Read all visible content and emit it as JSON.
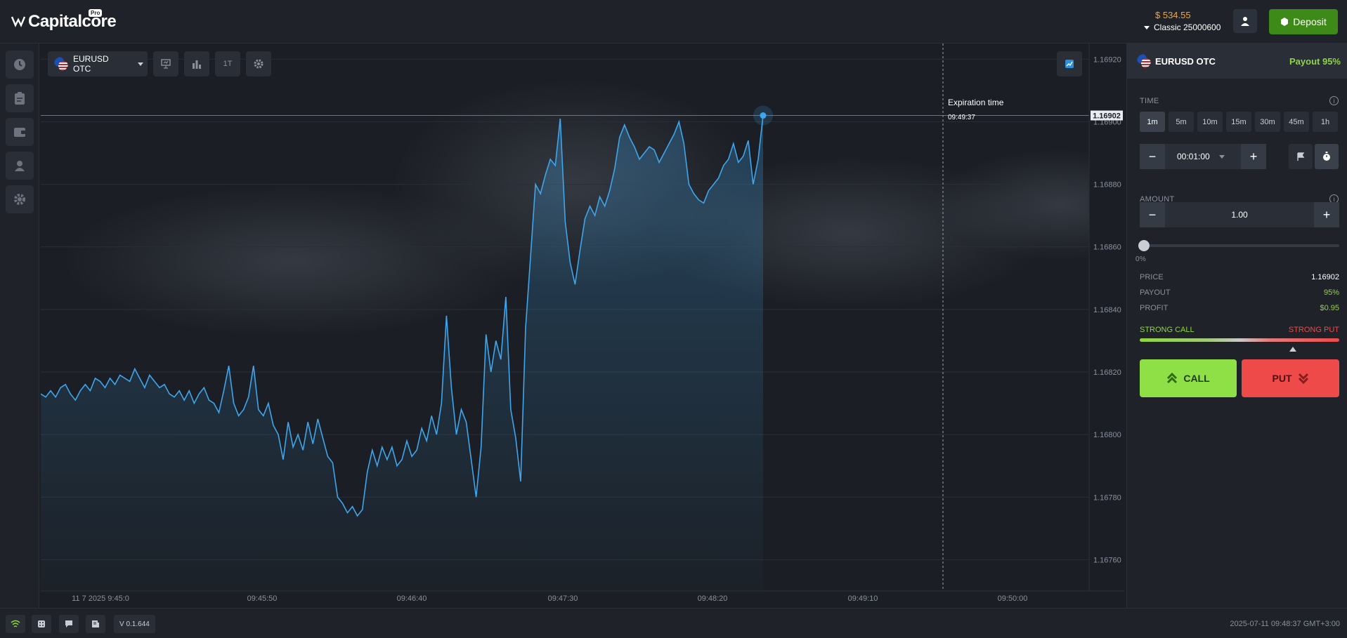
{
  "app": {
    "logo_text": "Capitalcore",
    "logo_badge": "Pro"
  },
  "header": {
    "balance": "$ 534.55",
    "account": "Classic 25000600",
    "deposit_label": "Deposit"
  },
  "toolbar": {
    "asset": "EURUSD OTC",
    "timeframe_label": "1T"
  },
  "chart": {
    "expiration_label": "Expiration time",
    "expiration_time": "09:49:37",
    "current_price": "1.16902",
    "line_color": "#3ea6ec"
  },
  "chart_data": {
    "type": "line",
    "title": "",
    "xlabel": "",
    "ylabel": "",
    "ylim": [
      1.1675,
      1.16925
    ],
    "x_ticks": [
      "11 7 2025 9:45:0",
      "09:45:50",
      "09:46:40",
      "09:47:30",
      "09:48:20",
      "09:49:10",
      "09:50:00"
    ],
    "y_ticks": [
      "1.16920",
      "1.16900",
      "1.16880",
      "1.16860",
      "1.16840",
      "1.16820",
      "1.16800",
      "1.16780",
      "1.16760"
    ],
    "series": [
      {
        "values": [
          1.16813,
          1.16812,
          1.16814,
          1.16812,
          1.16815,
          1.16816,
          1.16813,
          1.16811,
          1.16814,
          1.16816,
          1.16814,
          1.16818,
          1.16817,
          1.16815,
          1.16818,
          1.16816,
          1.16819,
          1.16818,
          1.16817,
          1.16821,
          1.16818,
          1.16815,
          1.16819,
          1.16817,
          1.16815,
          1.16816,
          1.16813,
          1.16812,
          1.16814,
          1.16811,
          1.16814,
          1.1681,
          1.16813,
          1.16815,
          1.16811,
          1.1681,
          1.16807,
          1.16814,
          1.16822,
          1.1681,
          1.16806,
          1.16808,
          1.16812,
          1.16822,
          1.16808,
          1.16806,
          1.1681,
          1.16803,
          1.168,
          1.16792,
          1.16804,
          1.16796,
          1.168,
          1.16795,
          1.16804,
          1.16797,
          1.16805,
          1.16799,
          1.16793,
          1.16791,
          1.1678,
          1.16778,
          1.16775,
          1.16777,
          1.16774,
          1.16776,
          1.16788,
          1.16795,
          1.1679,
          1.16796,
          1.16792,
          1.16796,
          1.1679,
          1.16792,
          1.16798,
          1.16793,
          1.16795,
          1.16802,
          1.16798,
          1.16806,
          1.168,
          1.1681,
          1.16838,
          1.16815,
          1.168,
          1.16808,
          1.16804,
          1.16792,
          1.1678,
          1.16796,
          1.16832,
          1.1682,
          1.1683,
          1.16824,
          1.16844,
          1.16808,
          1.16799,
          1.16785,
          1.16834,
          1.16857,
          1.1688,
          1.16877,
          1.16883,
          1.16888,
          1.16886,
          1.16901,
          1.16868,
          1.16855,
          1.16848,
          1.16859,
          1.16869,
          1.16873,
          1.1687,
          1.16876,
          1.16873,
          1.16878,
          1.16885,
          1.16895,
          1.16899,
          1.16895,
          1.16892,
          1.16888,
          1.1689,
          1.16892,
          1.16891,
          1.16887,
          1.1689,
          1.16893,
          1.16896,
          1.169,
          1.16893,
          1.1688,
          1.16877,
          1.16875,
          1.16874,
          1.16878,
          1.1688,
          1.16882,
          1.16886,
          1.16888,
          1.16893,
          1.16887,
          1.16889,
          1.16894,
          1.1688,
          1.16888,
          1.16902
        ]
      }
    ]
  },
  "panel": {
    "asset": "EURUSD OTC",
    "payout_header": "Payout 95%",
    "time_label": "TIME",
    "time_options": [
      "1m",
      "5m",
      "10m",
      "15m",
      "30m",
      "45m",
      "1h"
    ],
    "time_value": "00:01:00",
    "amount_label": "AMOUNT",
    "amount_value": "1.00",
    "slider_label": "0%",
    "slider_value": 0,
    "price_label": "PRICE",
    "price_value": "1.16902",
    "payout_label": "PAYOUT",
    "payout_value": "95%",
    "profit_label": "PROFIT",
    "profit_value": "$0.95",
    "strong_call": "STRONG CALL",
    "strong_put": "STRONG PUT",
    "call_label": "CALL",
    "put_label": "PUT"
  },
  "footer": {
    "version": "V 0.1.644",
    "datetime": "2025-07-11 09:48:37 GMT+3:00"
  },
  "colors": {
    "call": "#8fe047",
    "put": "#ef4a4a",
    "deposit": "#3d8a19",
    "balance": "#f7a531"
  }
}
